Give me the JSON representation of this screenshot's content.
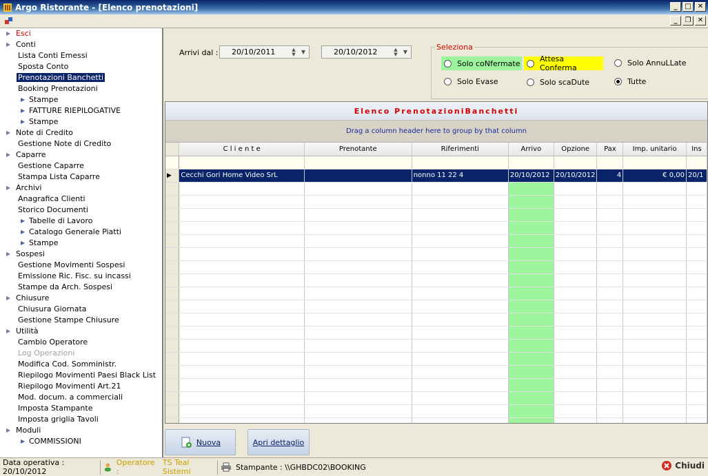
{
  "window": {
    "title": "Argo Ristorante - [Elenco prenotazioni]"
  },
  "sidebar": {
    "items": [
      {
        "label": "Esci",
        "level": 0,
        "expander": true,
        "style": "red"
      },
      {
        "label": "Conti",
        "level": 0,
        "expander": true
      },
      {
        "label": "Lista Conti Emessi",
        "level": 1
      },
      {
        "label": "Sposta Conto",
        "level": 1
      },
      {
        "label": "Prenotazioni Banchetti",
        "level": 1,
        "selected": true
      },
      {
        "label": "Booking Prenotazioni",
        "level": 1
      },
      {
        "label": "Stampe",
        "level": 2,
        "expander": true
      },
      {
        "label": "FATTURE RIEPILOGATIVE",
        "level": 2,
        "expander": true
      },
      {
        "label": "Stampe",
        "level": 2,
        "expander": true
      },
      {
        "label": "Note di Credito",
        "level": 0,
        "expander": true
      },
      {
        "label": "Gestione Note di Credito",
        "level": 1
      },
      {
        "label": "Caparre",
        "level": 0,
        "expander": true
      },
      {
        "label": "Gestione Caparre",
        "level": 1
      },
      {
        "label": "Stampa Lista Caparre",
        "level": 1
      },
      {
        "label": "Archivi",
        "level": 0,
        "expander": true
      },
      {
        "label": "Anagrafica Clienti",
        "level": 1
      },
      {
        "label": "Storico Documenti",
        "level": 1
      },
      {
        "label": "Tabelle di Lavoro",
        "level": 2,
        "expander": true
      },
      {
        "label": "Catalogo Generale Piatti",
        "level": 2,
        "expander": true
      },
      {
        "label": "Stampe",
        "level": 2,
        "expander": true
      },
      {
        "label": "Sospesi",
        "level": 0,
        "expander": true
      },
      {
        "label": "Gestione Movimenti Sospesi",
        "level": 1
      },
      {
        "label": "Emissione Ric. Fisc. su incassi",
        "level": 1
      },
      {
        "label": "Stampe da Arch. Sospesi",
        "level": 1
      },
      {
        "label": "Chiusure",
        "level": 0,
        "expander": true
      },
      {
        "label": "Chiusura Giornata",
        "level": 1
      },
      {
        "label": "Gestione Stampe Chiusure",
        "level": 1
      },
      {
        "label": "Utilità",
        "level": 0,
        "expander": true
      },
      {
        "label": "Cambio Operatore",
        "level": 1
      },
      {
        "label": "Log Operazioni",
        "level": 1,
        "style": "disabled"
      },
      {
        "label": "Modifica Cod. Somministr.",
        "level": 1
      },
      {
        "label": "Riepilogo Movimenti Paesi Black List",
        "level": 1
      },
      {
        "label": "Riepilogo Movimenti Art.21",
        "level": 1
      },
      {
        "label": "Mod. docum. a commerciali",
        "level": 1
      },
      {
        "label": "Imposta Stampante",
        "level": 1
      },
      {
        "label": "Imposta griglia Tavoli",
        "level": 1
      },
      {
        "label": "Moduli",
        "level": 0,
        "expander": true
      },
      {
        "label": "COMMISSIONI",
        "level": 2,
        "expander": true
      }
    ]
  },
  "filters": {
    "date_label": "Arrivi dal :",
    "date_from": "20/10/2011",
    "date_to": "20/10/2012",
    "selection_title": "Seleziona",
    "options": [
      {
        "label": "Solo coNfermate",
        "checked": false,
        "bg": "#9cf59c"
      },
      {
        "label": "Attesa Conferma",
        "checked": false,
        "bg": "#ffff00"
      },
      {
        "label": "Solo AnnuLLate",
        "checked": false,
        "bg": ""
      },
      {
        "label": "Solo Evase",
        "checked": false,
        "bg": ""
      },
      {
        "label": "Solo scaDute",
        "checked": false,
        "bg": ""
      },
      {
        "label": "Tutte",
        "checked": true,
        "bg": ""
      }
    ]
  },
  "grid": {
    "title": "Elenco PrenotazioniBanchetti",
    "group_hint": "Drag a column header here to group by that column",
    "columns": [
      "C l i e n t e",
      "Prenotante",
      "Riferimenti",
      "Arrivo",
      "Opzione",
      "Pax",
      "Imp. unitario",
      "Ins"
    ],
    "rows": [
      [
        "Cecchi Gori Home Video SrL",
        "",
        "nonno 11 22 4",
        "20/10/2012",
        "20/10/2012",
        "4",
        "€ 0,00",
        "20/1"
      ]
    ],
    "arrival_color": "#9cf59c"
  },
  "buttons": {
    "new_label": "Nuova",
    "open_label": "Apri dettaglio"
  },
  "status": {
    "data_operativa": "Data operativa : 20/10/2012",
    "operatore_label": "Operatore :",
    "operatore_value": "TS Teal Sistemi",
    "stampante": "Stampante : \\\\GHBDC02\\BOOKING",
    "close_label": "Chiudi"
  }
}
